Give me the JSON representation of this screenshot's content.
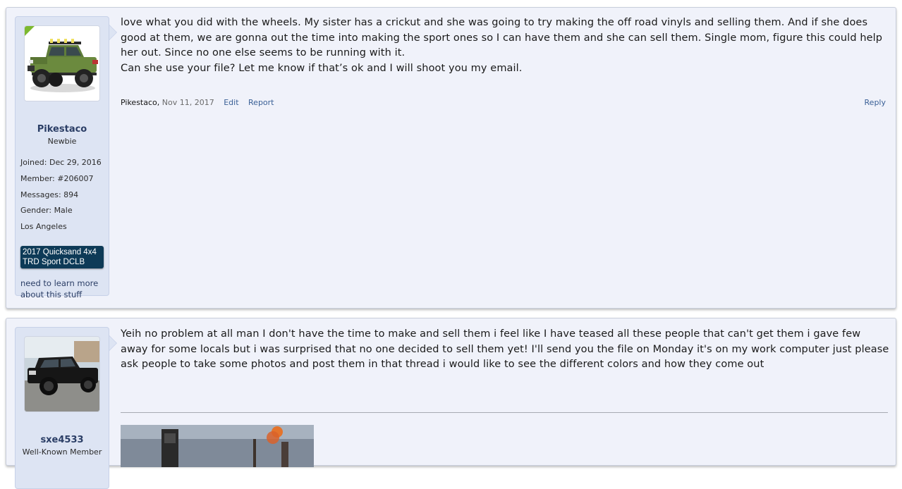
{
  "posts": [
    {
      "user": {
        "name": "Pikestaco",
        "title": "Newbie",
        "stats": [
          {
            "label": "Joined:",
            "value": "Dec 29, 2016"
          },
          {
            "label": "Member:",
            "value": "#206007"
          },
          {
            "label": "Messages:",
            "value": "894"
          },
          {
            "label": "Gender:",
            "value": "Male"
          }
        ],
        "location": "Los Angeles",
        "vehicle_banner": [
          "2017 Quicksand 4x4",
          "TRD Sport DCLB"
        ],
        "signature": "need to learn more about this stuff"
      },
      "message": [
        "love what you did with the wheels. My sister has a crickut and she was going to try making the off road vinyls and selling them. And if she does good at them, we are gonna out the time into making the sport ones so I can have them and she can sell them. Single mom, figure this could help her out. Since no one else seems to be running with it.",
        "Can she use your file? Let me know if that’s ok and I will shoot you my email."
      ],
      "meta": {
        "author": "Pikestaco,",
        "date": "Nov 11, 2017",
        "edit_label": "Edit",
        "report_label": "Report",
        "reply_label": "Reply"
      }
    },
    {
      "user": {
        "name": "sxe4533",
        "title": "Well-Known Member"
      },
      "message": [
        "Yeih no problem at all man I don't have the time to make and sell them i feel like I have teased all these people that can't get them i gave few away for some locals but i was surprised that no one decided to sell them yet! I'll send you the file on Monday it's on my work computer just please ask people to take some photos and post them in that thread i would like to see the different colors and how they come out"
      ]
    }
  ],
  "colors": {
    "post_bg": "#f0f2fa",
    "panel_bg": "#dde4f3",
    "link": "#3a6096",
    "username": "#2b3e66",
    "banner": "#0d3a57",
    "newbie_badge": "#7cb82f"
  },
  "icons": [
    "truck-avatar-green",
    "truck-avatar-black",
    "attachment-image"
  ]
}
